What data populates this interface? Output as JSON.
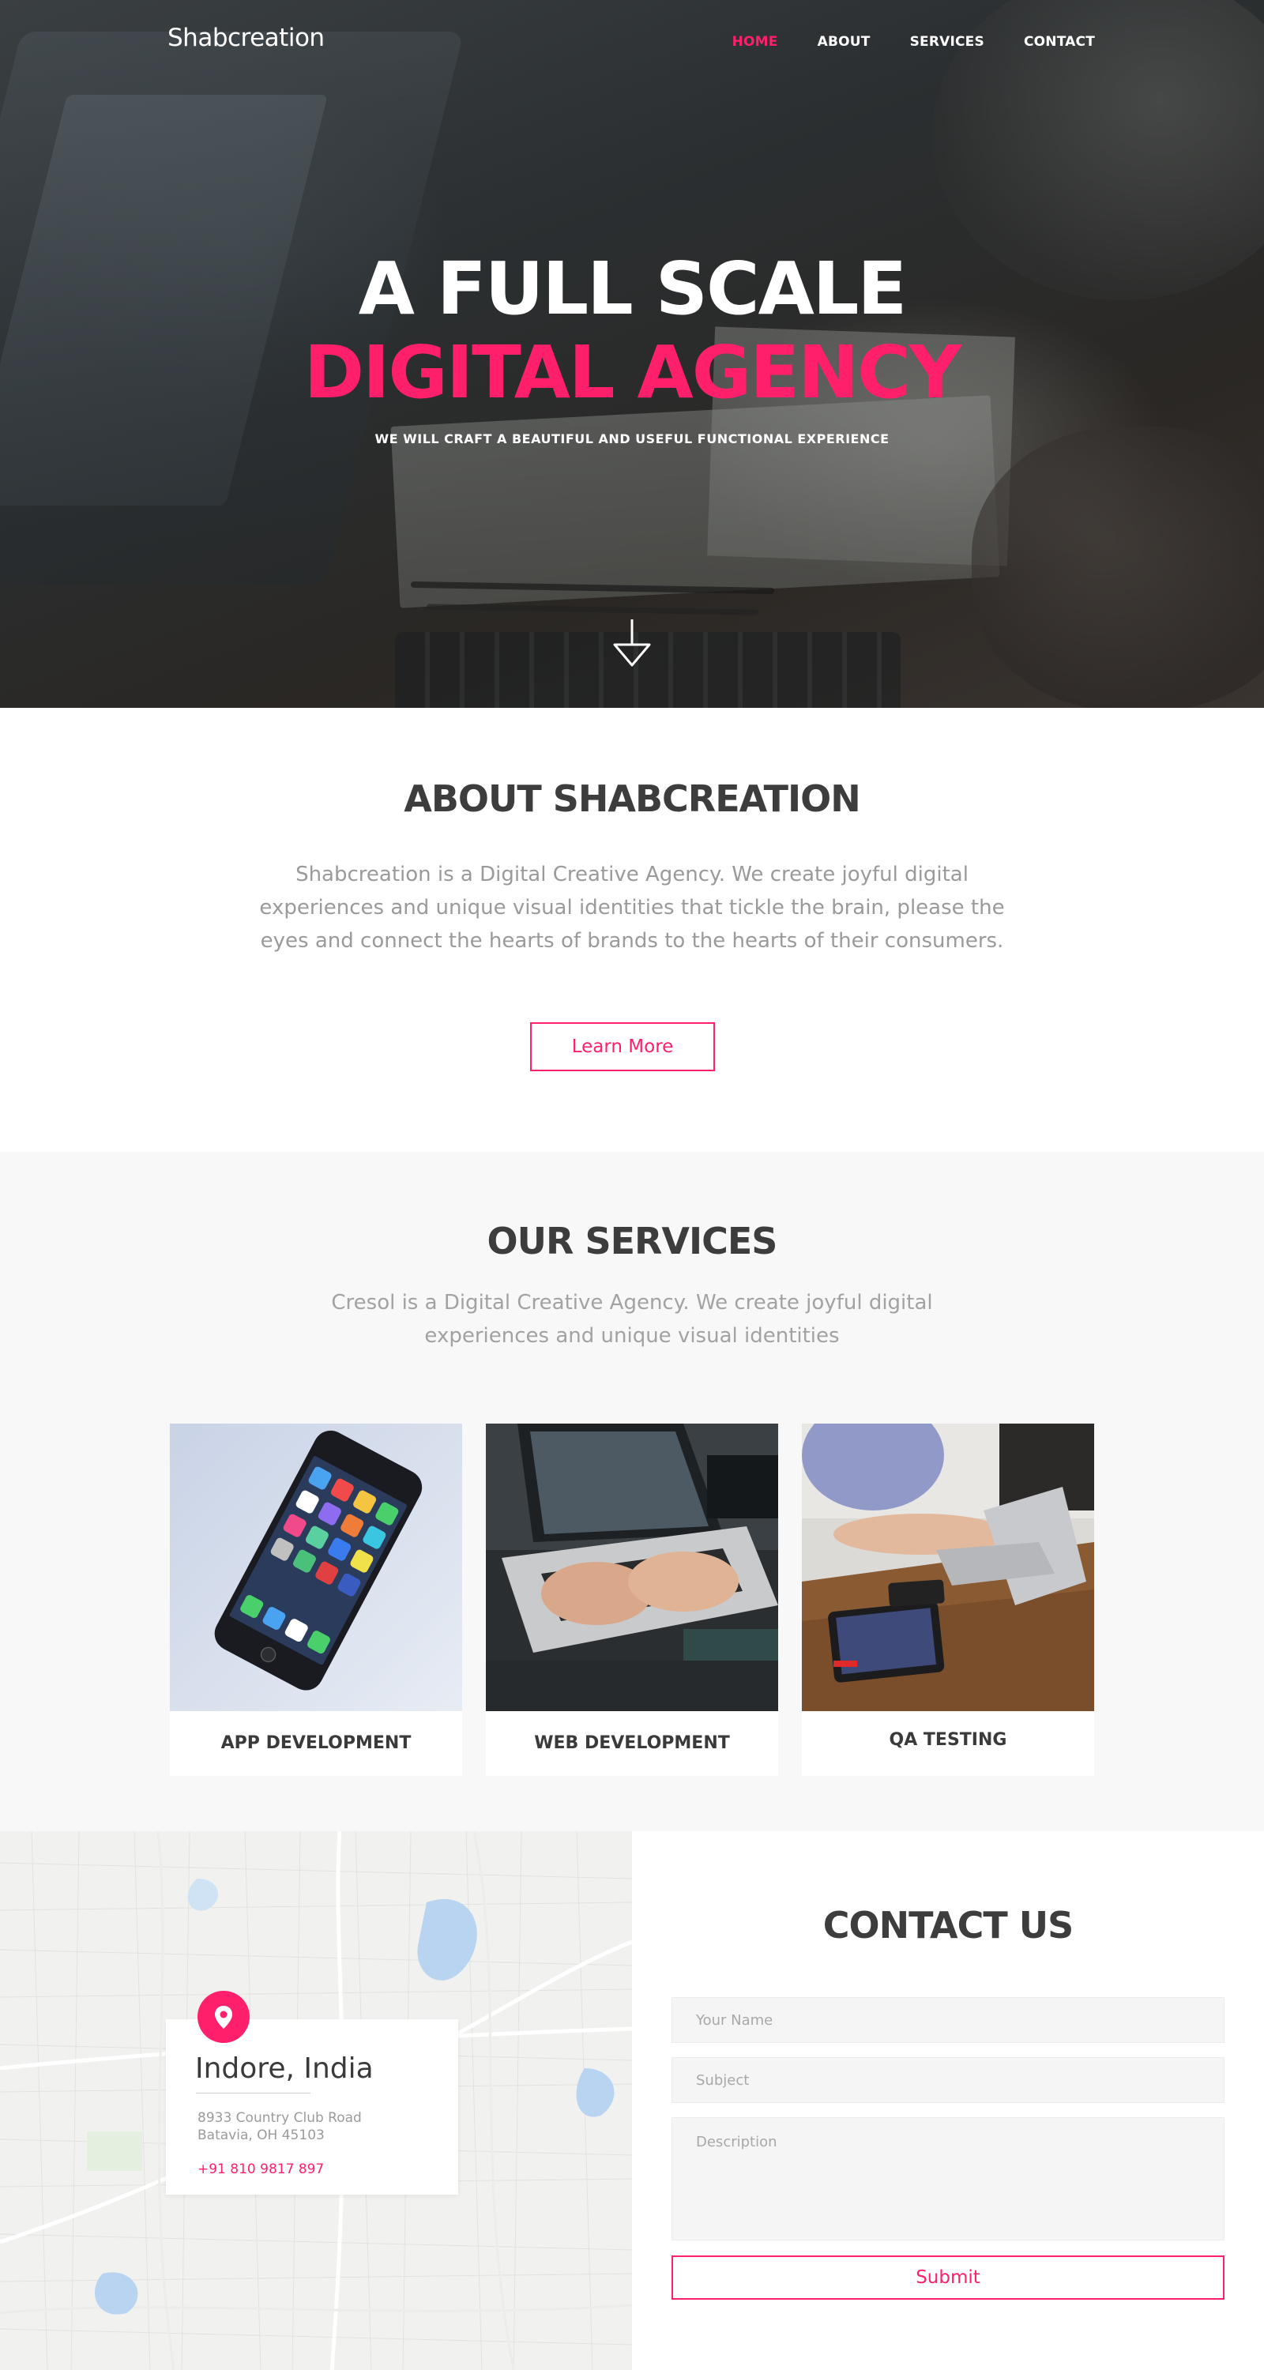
{
  "brand": {
    "name": "Shabcreation",
    "accent": "#ff1f6b"
  },
  "nav": {
    "items": [
      {
        "label": "HOME",
        "active": true
      },
      {
        "label": "ABOUT",
        "active": false
      },
      {
        "label": "SERVICES",
        "active": false
      },
      {
        "label": "CONTACT",
        "active": false
      }
    ]
  },
  "hero": {
    "title_line1": "A FULL SCALE",
    "title_line2": "DIGITAL AGENCY",
    "subtitle": "WE WILL CRAFT A BEAUTIFUL AND USEFUL FUNCTIONAL EXPERIENCE",
    "scroll_icon": "arrow-down-icon"
  },
  "about": {
    "title": "ABOUT SHABCREATION",
    "text": "Shabcreation is a Digital Creative Agency. We create joyful digital experiences and unique visual identities that tickle the brain, please the eyes and connect the hearts of brands to the hearts of their consumers.",
    "button": "Learn More"
  },
  "services": {
    "title": "OUR SERVICES",
    "text": "Cresol is a Digital Creative Agency. We create joyful digital experiences and unique visual identities",
    "cards": [
      {
        "label": "APP DEVELOPMENT"
      },
      {
        "label": "WEB DEVELOPMENT"
      },
      {
        "label": "QA TESTING"
      }
    ]
  },
  "location": {
    "icon": "map-pin-icon",
    "city": "Indore, India",
    "address_line1": "8933 Country Club Road",
    "address_line2": "Batavia, OH 45103",
    "phone": "+91 810 9817 897"
  },
  "contact": {
    "title": "CONTACT US",
    "name_placeholder": "Your Name",
    "subject_placeholder": "Subject",
    "description_placeholder": "Description",
    "submit": "Submit"
  }
}
